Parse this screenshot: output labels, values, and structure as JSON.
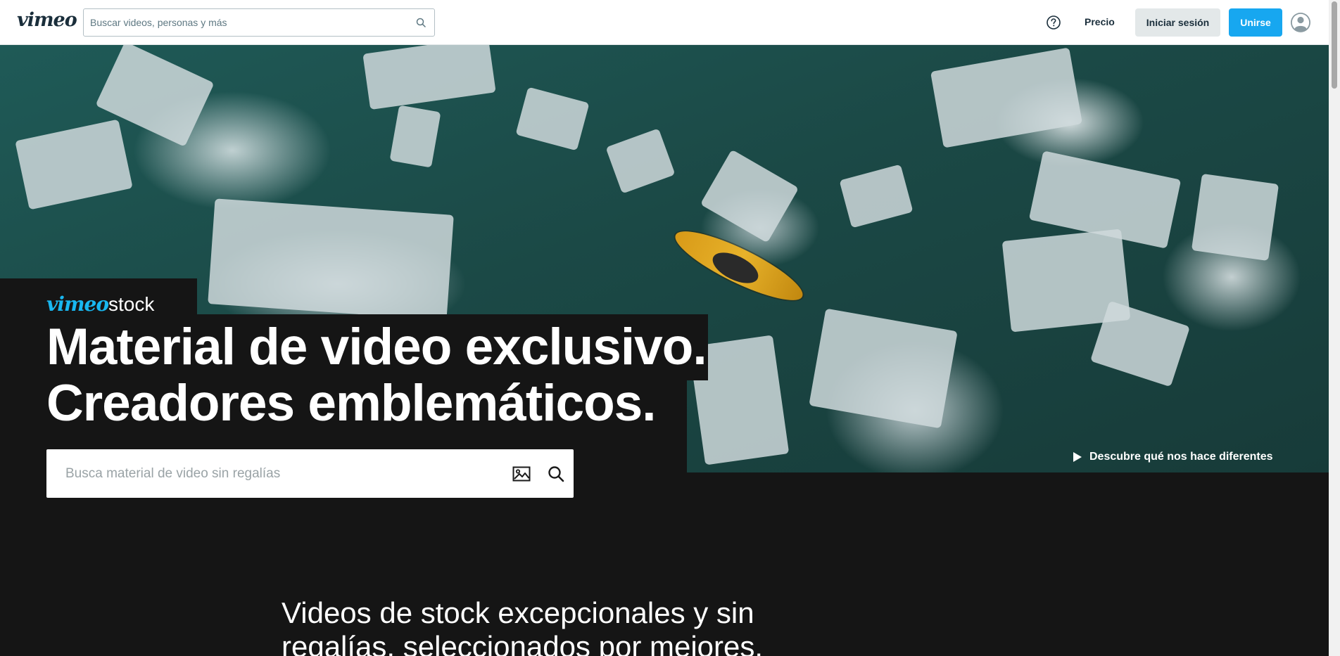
{
  "header": {
    "logo_text": "vimeo",
    "search_placeholder": "Buscar videos, personas y más",
    "links": {
      "pricing": "Precio"
    },
    "buttons": {
      "login": "Iniciar sesión",
      "join": "Unirse"
    },
    "icons": [
      "search-icon",
      "help-icon",
      "avatar-icon"
    ],
    "colors": {
      "join_bg": "#17a7f0",
      "login_bg": "#e3e8e9",
      "text": "#1a2e3b"
    }
  },
  "hero": {
    "brand_vimeo": "vimeo",
    "brand_stock": "stock",
    "headline_line1": "Material de video exclusivo.",
    "headline_line2": "Creadores emblemáticos.",
    "cta_label": "Descubre qué nos hace diferentes",
    "search_placeholder": "Busca material de video sin regalías",
    "icons": [
      "play-icon",
      "image-search-icon",
      "search-icon"
    ],
    "colors": {
      "brand_accent": "#19b7f0",
      "panel_bg": "#151515"
    }
  },
  "intro": {
    "tagline": "Videos de stock excepcionales y sin regalías, seleccionados por mejores."
  }
}
